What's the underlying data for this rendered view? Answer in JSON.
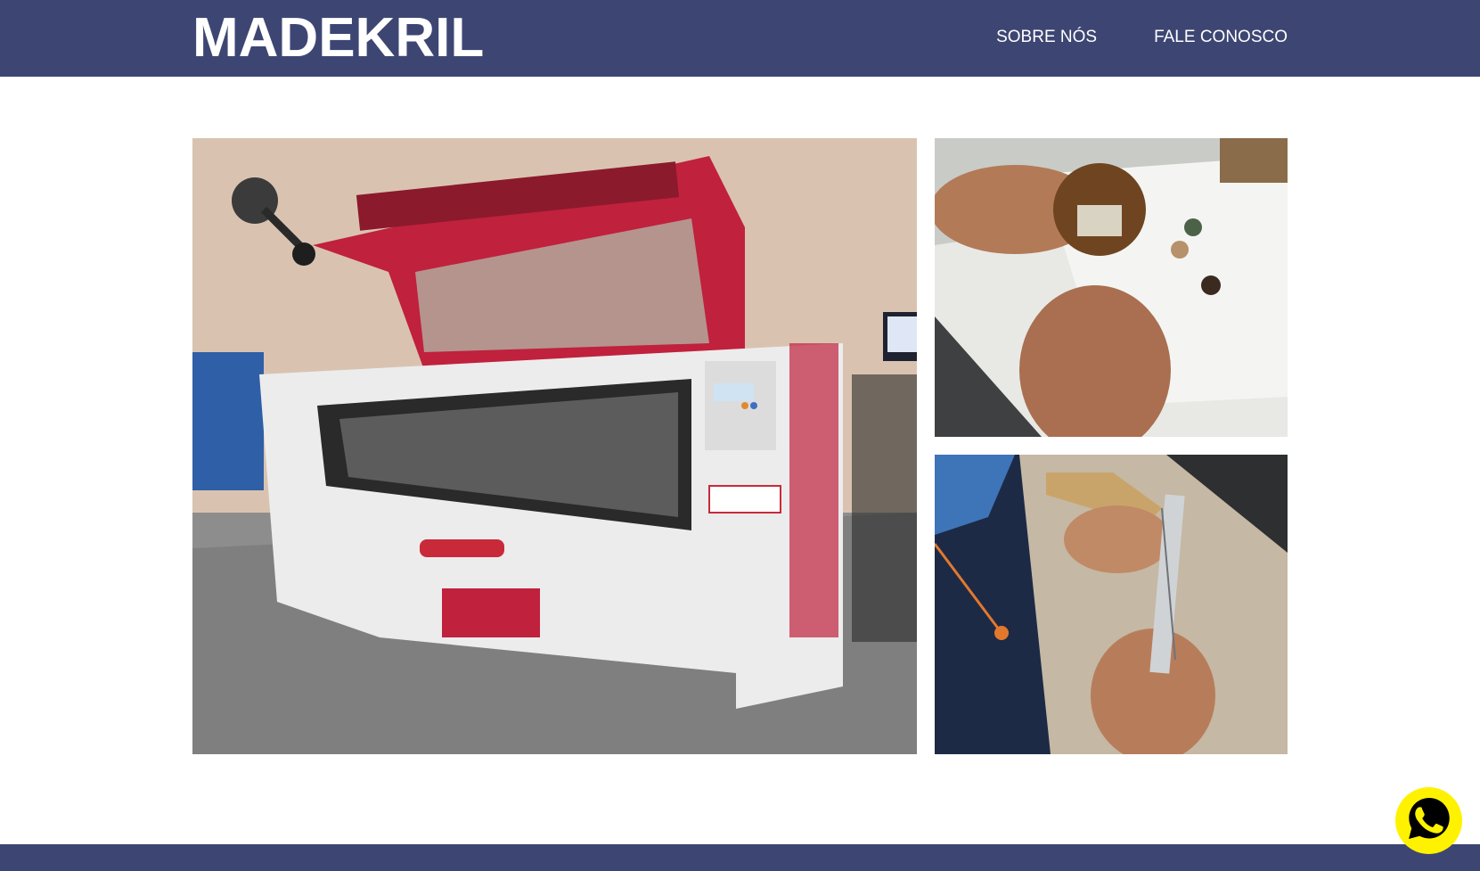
{
  "header": {
    "logo": "MADEKRIL",
    "nav": [
      {
        "label": "SOBRE NÓS"
      },
      {
        "label": "FALE CONOSCO"
      }
    ]
  },
  "gallery": {
    "images": [
      {
        "icon": "laser-cutting-machine-photo"
      },
      {
        "icon": "hands-holding-wood-piece-photo"
      },
      {
        "icon": "measuring-with-caliper-photo"
      }
    ]
  },
  "floating": {
    "icon": "whatsapp-icon"
  },
  "colors": {
    "header_bg": "#3d4673",
    "footer_bg": "#3d4673",
    "whatsapp_button": "#fff200",
    "text": "#ffffff"
  }
}
